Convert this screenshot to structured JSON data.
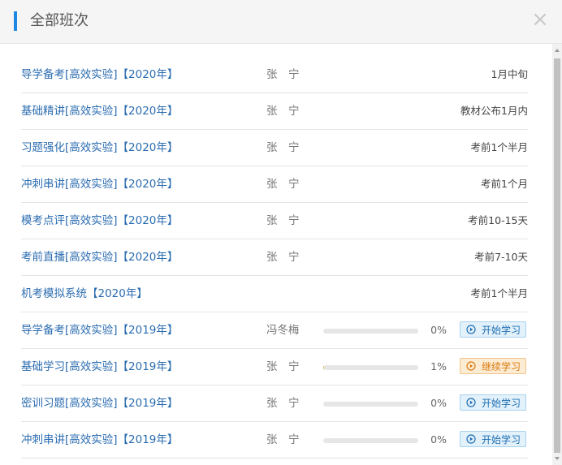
{
  "header": {
    "title": "全部班次",
    "close_icon": "close-icon",
    "accent_color": "#1e88e5"
  },
  "courses": [
    {
      "name": "导学备考[高效实验]【2020年】",
      "teacher": "张　宁",
      "time": "1月中旬"
    },
    {
      "name": "基础精讲[高效实验]【2020年】",
      "teacher": "张　宁",
      "time": "教材公布1月内"
    },
    {
      "name": "习题强化[高效实验]【2020年】",
      "teacher": "张　宁",
      "time": "考前1个半月"
    },
    {
      "name": "冲刺串讲[高效实验]【2020年】",
      "teacher": "张　宁",
      "time": "考前1个月"
    },
    {
      "name": "模考点评[高效实验]【2020年】",
      "teacher": "张　宁",
      "time": "考前10-15天"
    },
    {
      "name": "考前直播[高效实验]【2020年】",
      "teacher": "张　宁",
      "time": "考前7-10天"
    },
    {
      "name": "机考模拟系统【2020年】",
      "teacher": "",
      "time": "考前1个半月"
    },
    {
      "name": "导学备考[高效实验]【2019年】",
      "teacher": "冯冬梅",
      "progress": 0,
      "pct": "0%",
      "action": "开始学习",
      "action_type": "start"
    },
    {
      "name": "基础学习[高效实验]【2019年】",
      "teacher": "张　宁",
      "progress": 1,
      "pct": "1%",
      "action": "继续学习",
      "action_type": "continue"
    },
    {
      "name": "密训习题[高效实验]【2019年】",
      "teacher": "张　宁",
      "progress": 0,
      "pct": "0%",
      "action": "开始学习",
      "action_type": "start"
    },
    {
      "name": "冲刺串讲[高效实验]【2019年】",
      "teacher": "张　宁",
      "progress": 0,
      "pct": "0%",
      "action": "开始学习",
      "action_type": "start"
    }
  ],
  "colors": {
    "link": "#2b6cb0",
    "start_button": "#1e6fb3",
    "continue_button": "#d97a0e",
    "progress_fill": "#d4b23c"
  }
}
